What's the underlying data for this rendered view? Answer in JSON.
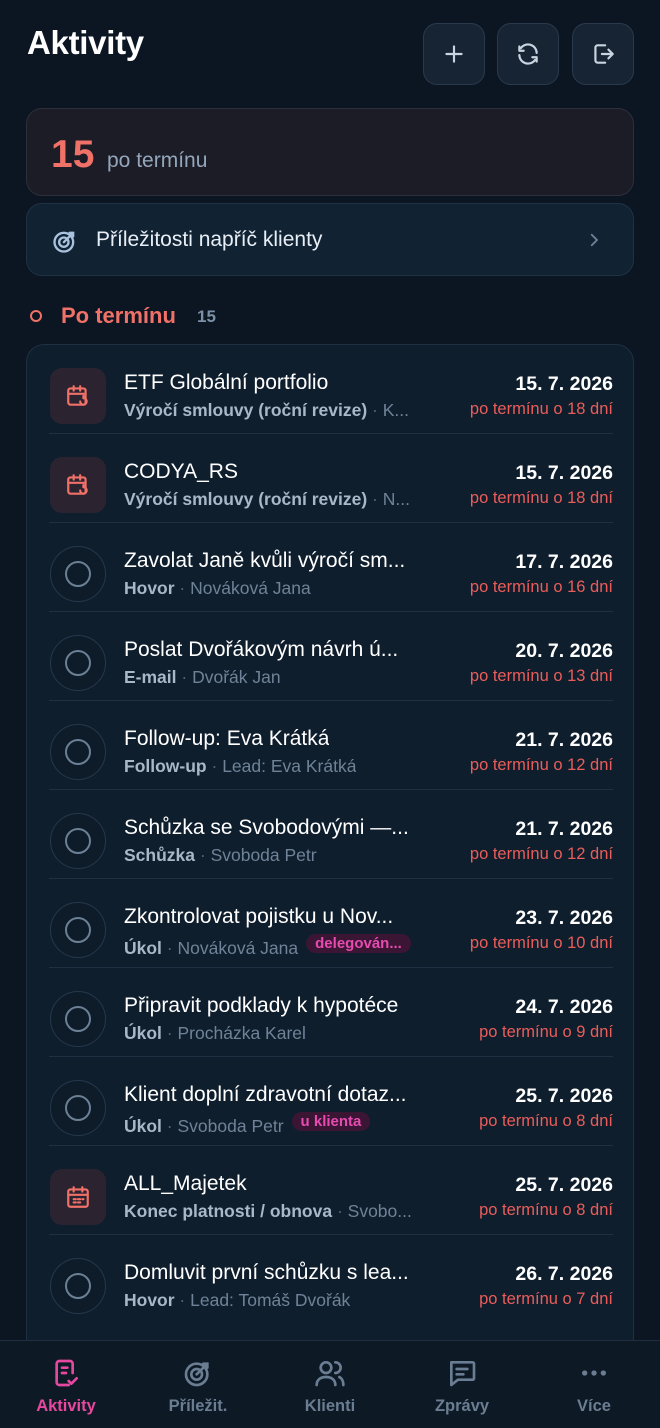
{
  "header": {
    "title": "Aktivity"
  },
  "overdue": {
    "count": "15",
    "label": "po termínu"
  },
  "opportunities": {
    "label": "Příležitosti napříč klienty"
  },
  "section": {
    "title": "Po termínu",
    "count": "15"
  },
  "items": [
    {
      "kind": "calendar-refresh",
      "title": "ETF Globální portfolio",
      "type": "Výročí smlouvy (roční revize)",
      "who": "K...",
      "tag": "",
      "date": "15. 7. 2026",
      "late": "po termínu o 18 dní"
    },
    {
      "kind": "calendar-refresh",
      "title": "CODYA_RS",
      "type": "Výročí smlouvy (roční revize)",
      "who": "N...",
      "tag": "",
      "date": "15. 7. 2026",
      "late": "po termínu o 18 dní"
    },
    {
      "kind": "task",
      "title": "Zavolat Janě kvůli výročí sm...",
      "type": "Hovor",
      "who": "Nováková Jana",
      "tag": "",
      "date": "17. 7. 2026",
      "late": "po termínu o 16 dní"
    },
    {
      "kind": "task",
      "title": "Poslat Dvořákovým návrh ú...",
      "type": "E-mail",
      "who": "Dvořák Jan",
      "tag": "",
      "date": "20. 7. 2026",
      "late": "po termínu o 13 dní"
    },
    {
      "kind": "task",
      "title": "Follow-up: Eva Krátká",
      "type": "Follow-up",
      "who": "Lead: Eva Krátká",
      "tag": "",
      "date": "21. 7. 2026",
      "late": "po termínu o 12 dní"
    },
    {
      "kind": "task",
      "title": "Schůzka se Svobodovými —...",
      "type": "Schůzka",
      "who": "Svoboda Petr",
      "tag": "",
      "date": "21. 7. 2026",
      "late": "po termínu o 12 dní"
    },
    {
      "kind": "task",
      "title": "Zkontrolovat pojistku u Nov...",
      "type": "Úkol",
      "who": "Nováková Jana",
      "tag": "delegován...",
      "date": "23. 7. 2026",
      "late": "po termínu o 10 dní"
    },
    {
      "kind": "task",
      "title": "Připravit podklady k hypotéce",
      "type": "Úkol",
      "who": "Procházka Karel",
      "tag": "",
      "date": "24. 7. 2026",
      "late": "po termínu o 9 dní"
    },
    {
      "kind": "task",
      "title": "Klient doplní zdravotní dotaz...",
      "type": "Úkol",
      "who": "Svoboda Petr",
      "tag": "u klienta",
      "date": "25. 7. 2026",
      "late": "po termínu o 8 dní"
    },
    {
      "kind": "calendar",
      "title": "ALL_Majetek",
      "type": "Konec platnosti / obnova",
      "who": "Svobo...",
      "tag": "",
      "date": "25. 7. 2026",
      "late": "po termínu o 8 dní"
    },
    {
      "kind": "task",
      "title": "Domluvit první schůzku s lea...",
      "type": "Hovor",
      "who": "Lead: Tomáš Dvořák",
      "tag": "",
      "date": "26. 7. 2026",
      "late": "po termínu o 7 dní"
    }
  ],
  "tabs": [
    {
      "label": "Aktivity",
      "icon": "activities-icon",
      "active": true
    },
    {
      "label": "Příležit.",
      "icon": "target-icon",
      "active": false
    },
    {
      "label": "Klienti",
      "icon": "users-icon",
      "active": false
    },
    {
      "label": "Zprávy",
      "icon": "messages-icon",
      "active": false
    },
    {
      "label": "Více",
      "icon": "more-icon",
      "active": false
    }
  ],
  "colors": {
    "accent": "#e6489f",
    "overdue": "#f07167",
    "background": "#0b1622"
  }
}
